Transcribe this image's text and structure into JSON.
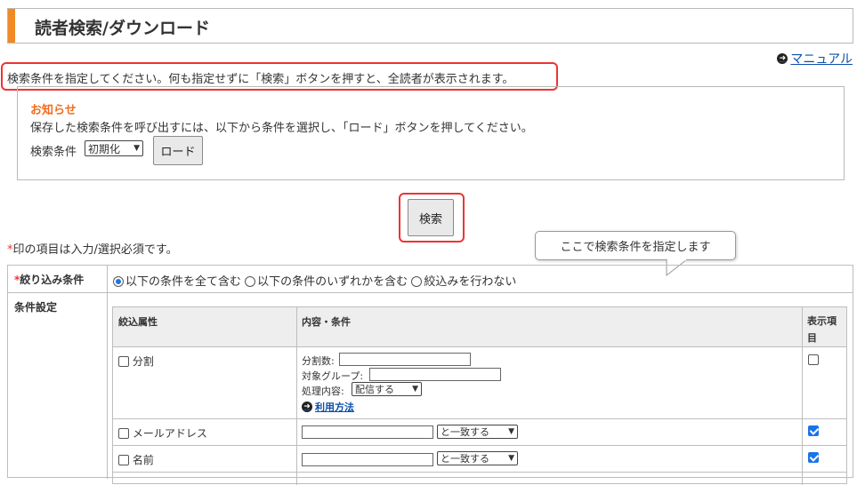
{
  "header": {
    "title": "読者検索/ダウンロード"
  },
  "manual_link": "マニュアル",
  "instruction": "検索条件を指定してください。何も指定せずに「検索」ボタンを押すと、全読者が表示されます。",
  "notice": {
    "title": "お知らせ",
    "text": "保存した検索条件を呼び出すには、以下から条件を選択し、「ロード」ボタンを押してください。",
    "condition_label": "検索条件",
    "condition_value": "初期化",
    "load_button": "ロード"
  },
  "search_button": "検索",
  "callout": "ここで検索条件を指定します",
  "required_note": "印の項目は入力/選択必須です。",
  "required_mark": "*",
  "filter": {
    "label": "絞り込み条件",
    "options": [
      "以下の条件を全て含む",
      "以下の条件のいずれかを含む",
      "絞込みを行わない"
    ],
    "selected": 0
  },
  "conditions": {
    "label": "条件設定",
    "headers": {
      "attr": "絞込属性",
      "content": "内容・条件",
      "display_l1": "表示項",
      "display_l2": "目"
    },
    "rows": [
      {
        "attr": "分割",
        "checked": false,
        "fields": {
          "split_count": "分割数:",
          "target_group": "対象グループ:",
          "process": "処理内容:",
          "process_value": "配信する",
          "usage_link": "利用方法"
        },
        "display": false
      },
      {
        "attr": "メールアドレス",
        "checked": false,
        "match": "と一致する",
        "display": true
      },
      {
        "attr": "名前",
        "checked": false,
        "match": "と一致する",
        "display": true
      }
    ]
  }
}
